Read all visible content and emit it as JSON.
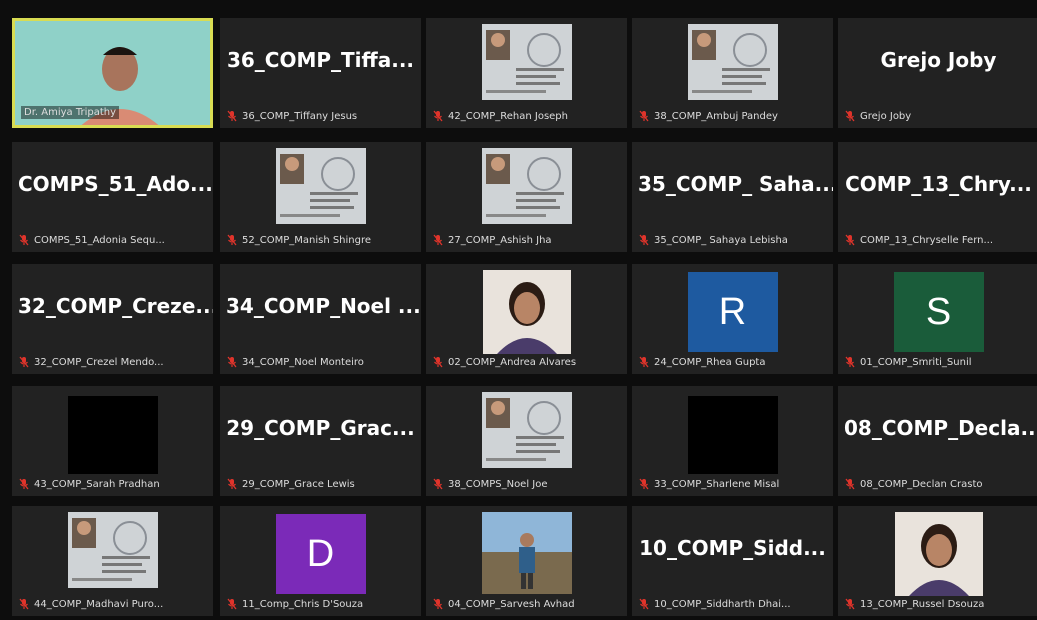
{
  "colors": {
    "active_border": "#d8dc52",
    "R": "#1e5aa0",
    "S": "#1a5c3a",
    "D": "#7b2ab8",
    "mic_muted": "#e0342b"
  },
  "tiles": [
    {
      "type": "video",
      "label": "Dr. Amiya Tripathy",
      "active": true
    },
    {
      "type": "name",
      "big": "36_COMP_Tiffa...",
      "label": "36_COMP_Tiffany Jesus"
    },
    {
      "type": "id",
      "label": "42_COMP_Rehan Joseph"
    },
    {
      "type": "id",
      "label": "38_COMP_Ambuj Pandey"
    },
    {
      "type": "name",
      "big": "Grejo Joby",
      "label": "Grejo Joby"
    },
    {
      "type": "name",
      "big": "COMPS_51_Ado...",
      "label": "COMPS_51_Adonia Sequ..."
    },
    {
      "type": "id",
      "label": "52_COMP_Manish Shingre"
    },
    {
      "type": "id",
      "label": "27_COMP_Ashish Jha"
    },
    {
      "type": "name",
      "big": "35_COMP_ Saha...",
      "label": "35_COMP_ Sahaya Lebisha"
    },
    {
      "type": "name",
      "big": "COMP_13_Chry...",
      "label": "COMP_13_Chryselle Fern..."
    },
    {
      "type": "name",
      "big": "32_COMP_Creze...",
      "label": "32_COMP_Crezel Mendo..."
    },
    {
      "type": "name",
      "big": "34_COMP_Noel ...",
      "label": "34_COMP_Noel Monteiro"
    },
    {
      "type": "portrait",
      "label": "02_COMP_Andrea Alvares"
    },
    {
      "type": "letter",
      "letter": "R",
      "color": "R",
      "label": "24_COMP_Rhea Gupta"
    },
    {
      "type": "letter",
      "letter": "S",
      "color": "S",
      "label": "01_COMP_Smriti_Sunil"
    },
    {
      "type": "black",
      "label": "43_COMP_Sarah Pradhan"
    },
    {
      "type": "name",
      "big": "29_COMP_Grac...",
      "label": "29_COMP_Grace Lewis"
    },
    {
      "type": "id",
      "label": "38_COMPS_Noel Joe"
    },
    {
      "type": "black",
      "label": "33_COMP_Sharlene Misal"
    },
    {
      "type": "name",
      "big": "08_COMP_Decla...",
      "label": "08_COMP_Declan Crasto"
    },
    {
      "type": "id",
      "label": "44_COMP_Madhavi Puro..."
    },
    {
      "type": "letter",
      "letter": "D",
      "color": "D",
      "label": "11_Comp_Chris D'Souza"
    },
    {
      "type": "photo",
      "label": "04_COMP_Sarvesh Avhad"
    },
    {
      "type": "name",
      "big": "10_COMP_Sidd...",
      "label": "10_COMP_Siddharth Dhai..."
    },
    {
      "type": "portrait",
      "label": "13_COMP_Russel Dsouza"
    }
  ]
}
